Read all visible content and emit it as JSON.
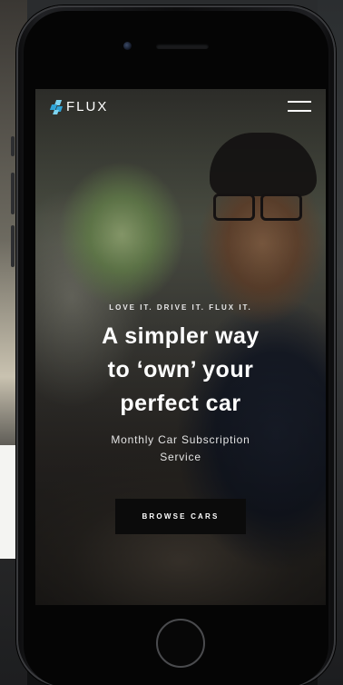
{
  "brand": {
    "name": "FLUX",
    "logo_icon": "flux-diamond-logo",
    "colors": {
      "logo_accent_a": "#2fa4d8",
      "logo_accent_b": "#7cd3f0"
    }
  },
  "nav": {
    "menu_icon": "hamburger-menu-icon"
  },
  "hero": {
    "tagline": "LOVE IT. DRIVE IT. FLUX IT.",
    "headline_lines": [
      "A simpler way",
      "to ‘own’ your",
      "perfect car"
    ],
    "subtitle_lines": [
      "Monthly Car Subscription",
      "Service"
    ],
    "cta_label": "BROWSE CARS"
  }
}
